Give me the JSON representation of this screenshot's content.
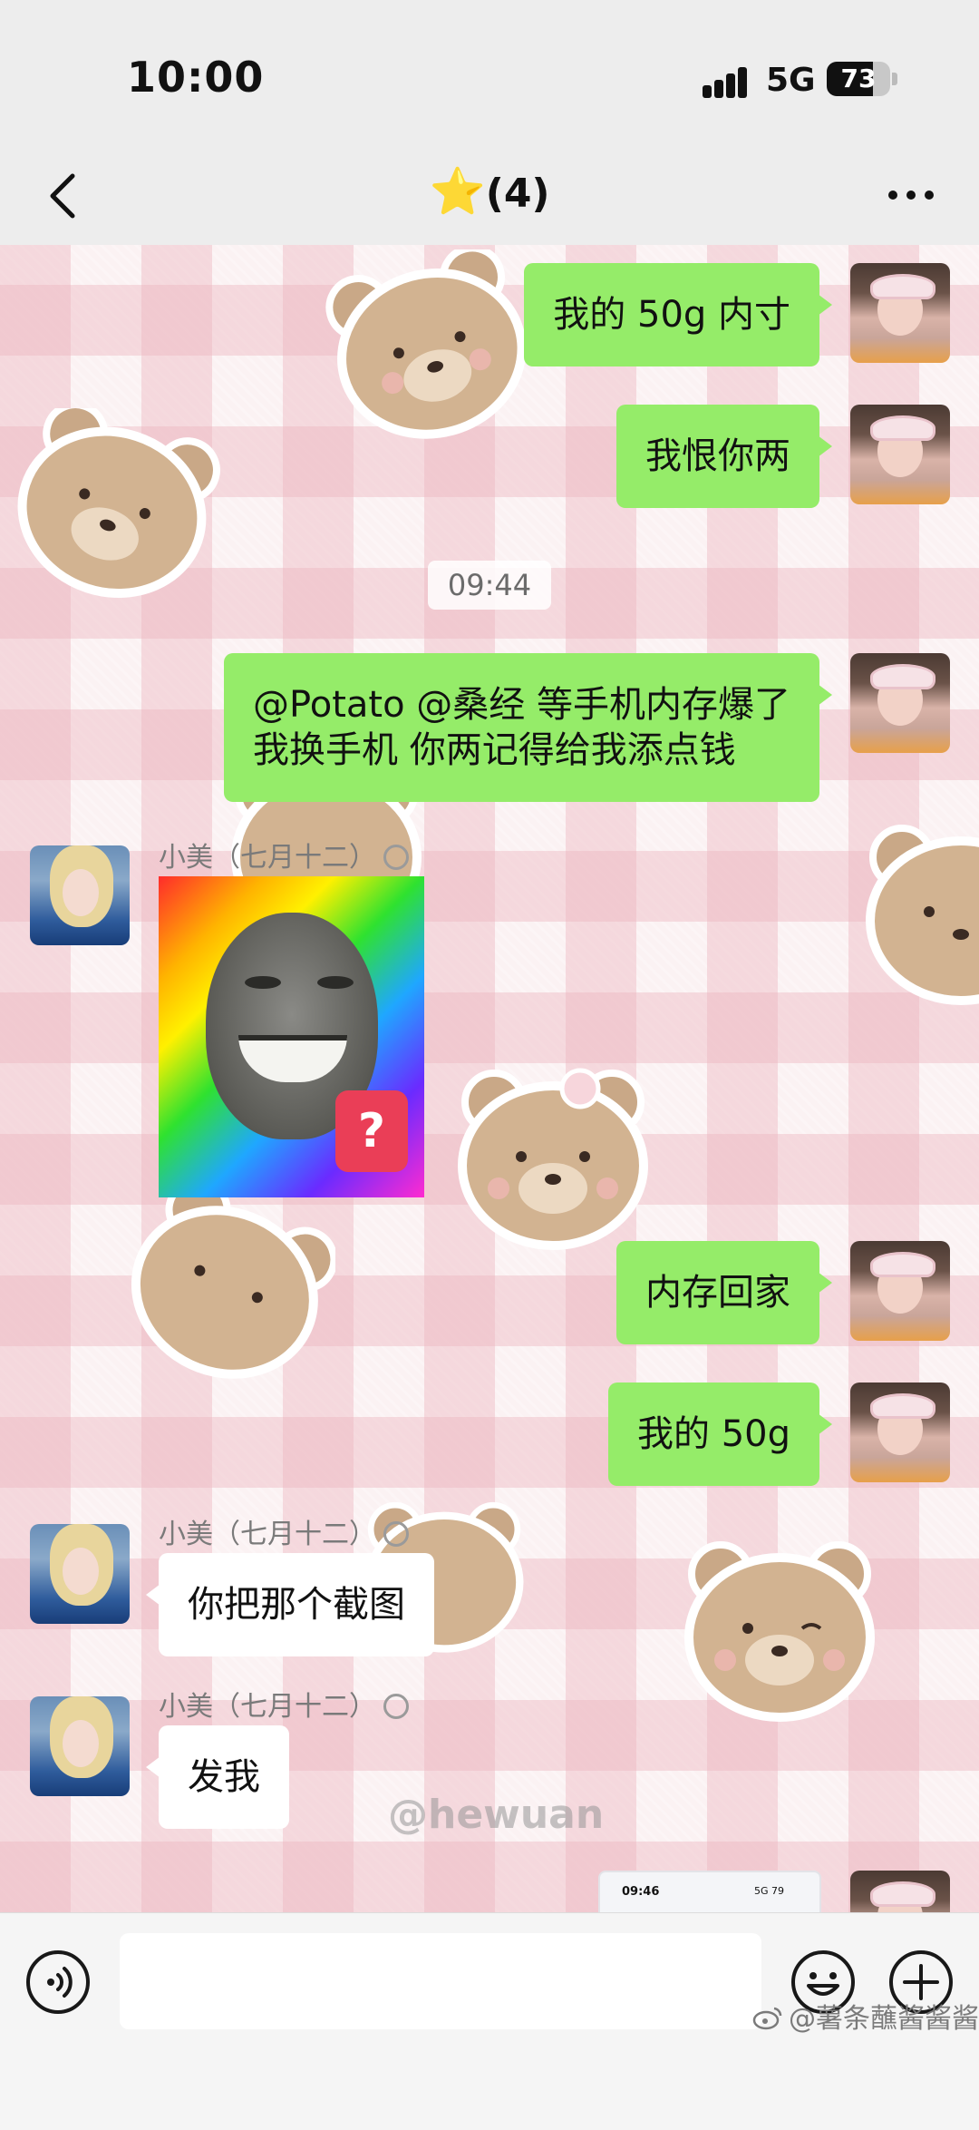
{
  "status_bar": {
    "time": "10:00",
    "network": "5G",
    "battery": "73",
    "battery_level": 0.73
  },
  "nav": {
    "title_star": "⭐",
    "title_count": "(4)"
  },
  "timestamp": "09:44",
  "messages": [
    {
      "from": "me",
      "text": "我的 50g 内寸"
    },
    {
      "from": "me",
      "text": "我恨你两"
    },
    {
      "from": "me",
      "text": "@Potato @桑经 等手机内存爆了\n我换手机 你两记得给我添点钱"
    },
    {
      "from": "her",
      "sender": "小美（七月十二）",
      "type": "sticker"
    },
    {
      "from": "me",
      "text": "内存回家"
    },
    {
      "from": "me",
      "text": "我的 50g"
    },
    {
      "from": "her",
      "sender": "小美（七月十二）",
      "text": "你把那个截图"
    },
    {
      "from": "her",
      "sender": "小美（七月十二）",
      "text": "发我"
    },
    {
      "from": "me",
      "type": "image",
      "preview_time": "09:46",
      "preview_status": "5G 79"
    }
  ],
  "sticker": {
    "badge": "?"
  },
  "watermarks": {
    "overlay": "@hewuan",
    "corner": "@薯条蘸酱酱酱"
  },
  "input": {
    "placeholder": ""
  },
  "icons": [
    "back-icon",
    "more-icon",
    "voice-icon",
    "emoji-icon",
    "plus-icon"
  ],
  "colors": {
    "my_bubble": "#95ec69",
    "her_bubble": "#ffffff",
    "bar": "#ededed"
  }
}
